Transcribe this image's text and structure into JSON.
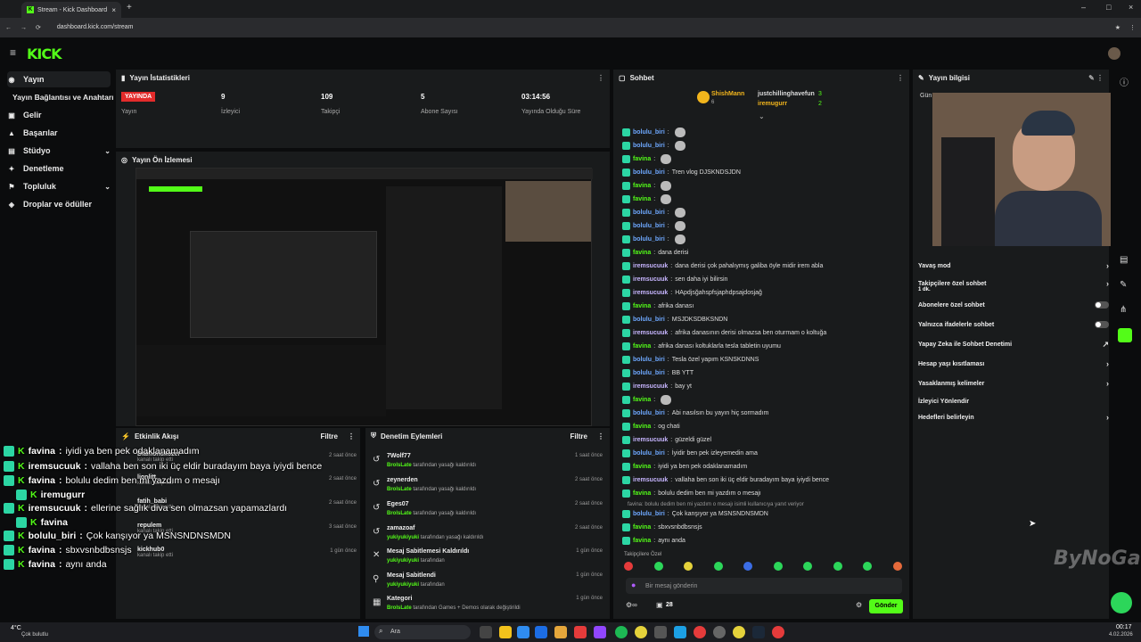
{
  "browser": {
    "tab_title": "Stream - Kick Dashboard",
    "url": "dashboard.kick.com/stream"
  },
  "brand": {
    "logo": "KICK",
    "accent": "#53fc18"
  },
  "sidebar": {
    "items": [
      {
        "label": "Yayın",
        "icon": "stream-icon"
      },
      {
        "label": "Yayın Bağlantısı ve Anahtarı",
        "icon": "key-icon"
      },
      {
        "label": "Gelir",
        "icon": "wallet-icon"
      },
      {
        "label": "Başarılar",
        "icon": "trophy-icon"
      },
      {
        "label": "Stüdyo",
        "icon": "studio-icon"
      },
      {
        "label": "Denetleme",
        "icon": "moderation-icon"
      },
      {
        "label": "Topluluk",
        "icon": "community-icon"
      },
      {
        "label": "Droplar ve ödüller",
        "icon": "drops-icon"
      }
    ]
  },
  "stats": {
    "title": "Yayın İstatistikleri",
    "live": "YAYINDA",
    "live_label": "Yayın",
    "items": [
      {
        "value": "9",
        "label": "İzleyici"
      },
      {
        "value": "109",
        "label": "Takipçi"
      },
      {
        "value": "5",
        "label": "Abone Sayısı"
      },
      {
        "value": "03:14:56",
        "label": "Yayında Olduğu Süre"
      }
    ]
  },
  "preview": {
    "title": "Yayın Ön İzlemesi"
  },
  "activity": {
    "title": "Etkinlik Akışı",
    "filter": "Filtre",
    "items": [
      {
        "name": "Diamondkozer",
        "sub": "kanalı takip etti",
        "time": "2 saat önce"
      },
      {
        "name": "lionlitt.",
        "sub": "kanalı takip etti",
        "time": "2 saat önce"
      },
      {
        "name": "fatih_babi",
        "sub": "kanalı takip etti",
        "time": "2 saat önce"
      },
      {
        "name": "repulem",
        "sub": "kanalı takip etti",
        "time": "3 saat önce"
      },
      {
        "name": "kickhub0",
        "sub": "kanalı takip etti",
        "time": "1 gün önce"
      }
    ]
  },
  "mod": {
    "title": "Denetim Eylemleri",
    "filter": "Filtre",
    "items": [
      {
        "name": "7Wolf77",
        "actor": "BrolsLate",
        "sub": "tarafından yasağı kaldırıldı",
        "time": "1 saat önce"
      },
      {
        "name": "zeynerden",
        "actor": "BrolsLate",
        "sub": "tarafından yasağı kaldırıldı",
        "time": "2 saat önce"
      },
      {
        "name": "Eges07",
        "actor": "BrolsLate",
        "sub": "tarafından yasağı kaldırıldı",
        "time": "2 saat önce"
      },
      {
        "name": "zamazoaf",
        "actor": "yukiyukiyuki",
        "sub": "tarafından yasağı kaldırıldı",
        "time": "2 saat önce"
      },
      {
        "name": "Mesaj Sabitlemesi Kaldırıldı",
        "actor": "yukiyukiyuki",
        "sub": "tarafından",
        "time": "1 gün önce"
      },
      {
        "name": "Mesaj Sabitlendi",
        "actor": "yukiyukiyuki",
        "sub": "tarafından",
        "time": "1 gün önce"
      },
      {
        "name": "Kategori",
        "actor": "BrolsLate",
        "sub": "tarafından Games + Demos olarak değiştirildi",
        "time": "1 gün önce"
      }
    ]
  },
  "chat": {
    "title": "Sohbet",
    "top": [
      {
        "name": "ShishMann",
        "count": "6"
      },
      {
        "name": "justchillinghavefun",
        "count": "3"
      },
      {
        "name": "iremugurr",
        "count": "2"
      }
    ],
    "messages": [
      {
        "user": "bolulu_biri",
        "text": "",
        "cls": "b"
      },
      {
        "user": "bolulu_biri",
        "text": "",
        "cls": "b"
      },
      {
        "user": "favina",
        "text": "",
        "cls": "f"
      },
      {
        "user": "bolulu_biri",
        "text": "Tren vlog DJSKNDSJDN",
        "cls": "b"
      },
      {
        "user": "favina",
        "text": "",
        "cls": "f"
      },
      {
        "user": "favina",
        "text": "",
        "cls": "f"
      },
      {
        "user": "bolulu_biri",
        "text": "",
        "cls": "b"
      },
      {
        "user": "bolulu_biri",
        "text": "",
        "cls": "b"
      },
      {
        "user": "bolulu_biri",
        "text": "",
        "cls": "b"
      },
      {
        "user": "favina",
        "text": "dana derisi",
        "cls": "f"
      },
      {
        "user": "iremsucuuk",
        "text": "dana derisi çok pahalıymış galiba öyle midir irem abla",
        "cls": "i"
      },
      {
        "user": "iremsucuuk",
        "text": "sen daha iyi bilirsin",
        "cls": "i"
      },
      {
        "user": "iremsucuuk",
        "text": "HApdjsğahspfsjaphdpsajdosjağ",
        "cls": "i"
      },
      {
        "user": "favina",
        "text": "afrika danası",
        "cls": "f"
      },
      {
        "user": "bolulu_biri",
        "text": "MSJDKSDBKSNDN",
        "cls": "b"
      },
      {
        "user": "iremsucuuk",
        "text": "afrika danasının derisi olmazsa ben oturmam o koltuğa",
        "cls": "i"
      },
      {
        "user": "favina",
        "text": "afrika danası koltuklarla tesla tabletin uyumu",
        "cls": "f"
      },
      {
        "user": "bolulu_biri",
        "text": "Tesla özel yapım KSNSKDNNS",
        "cls": "b"
      },
      {
        "user": "bolulu_biri",
        "text": "BB YTT",
        "cls": "b"
      },
      {
        "user": "iremsucuuk",
        "text": "bay yt",
        "cls": "i"
      },
      {
        "user": "favina",
        "text": "",
        "cls": "f"
      },
      {
        "user": "bolulu_biri",
        "text": "Abi nasılsın bu yayın hiç sormadım",
        "cls": "b"
      },
      {
        "user": "favina",
        "text": "og chati",
        "cls": "f"
      },
      {
        "user": "iremsucuuk",
        "text": "güzeldi güzel",
        "cls": "i"
      },
      {
        "user": "bolulu_biri",
        "text": "İyidir ben pek izleyemedin ama",
        "cls": "b"
      },
      {
        "user": "favina",
        "text": "iyidi ya ben pek odaklanamadım",
        "cls": "f"
      },
      {
        "user": "iremsucuuk",
        "text": "vallaha ben son iki üç eldir buradayım baya iyiydi bence",
        "cls": "i"
      },
      {
        "user": "favina",
        "text": "bolulu dedim ben mi yazdım o mesajı",
        "cls": "f"
      }
    ],
    "reply_note": "favina: bolulu dedim ben mi yazdım o mesajı isimli kullanıcıya yanıt veriyor",
    "messages2": [
      {
        "user": "bolulu_biri",
        "text": "Çok kanşıyor ya MSNSNDNSMDN",
        "cls": "b"
      },
      {
        "user": "favina",
        "text": "sbxvsnbdbsnsjs",
        "cls": "f"
      },
      {
        "user": "favina",
        "text": "aynı anda",
        "cls": "f"
      }
    ],
    "followers_only": "Takipçilere Özel",
    "input_placeholder": "Bir mesaj gönderin",
    "viewers": "28",
    "send": "Gönder"
  },
  "info": {
    "title": "Yayın bilgisi",
    "gun": "Gün"
  },
  "settings": {
    "items": [
      {
        "label": "Yavaş mod",
        "ctrl": "chevron"
      },
      {
        "label": "Takipçilere özel sohbet",
        "extra": "1 dk.",
        "ctrl": "chevron"
      },
      {
        "label": "Abonelere özel sohbet",
        "ctrl": "toggle"
      },
      {
        "label": "Yalnızca ifadelerle sohbet",
        "ctrl": "toggle"
      },
      {
        "label": "Yapay Zeka ile Sohbet Denetimi",
        "ctrl": "ext"
      },
      {
        "label": "Hesap yaşı kısıtlaması",
        "ctrl": "chevron"
      },
      {
        "label": "Yasaklanmış kelimeler",
        "ctrl": "chevron"
      },
      {
        "label": "İzleyici Yönlendir",
        "ctrl": "none"
      },
      {
        "label": "Hedefleri belirleyin",
        "ctrl": "chevron"
      }
    ]
  },
  "overlay": [
    {
      "user": "favina",
      "text": "iyidi ya ben pek odaklanamadım"
    },
    {
      "user": "iremsucuuk",
      "text": "vallaha ben son iki üç eldir buradayım baya iyiydi bence"
    },
    {
      "user": "favina",
      "text": "bolulu dedim ben mi yazdım o mesajı"
    },
    {
      "user": "iremugurr",
      "text": ""
    },
    {
      "user": "iremsucuuk",
      "text": "ellerine sağlık diva sen olmazsan yapamazlardı"
    },
    {
      "user": "favina",
      "text": ""
    },
    {
      "user": "bolulu_biri",
      "text": "Çok kanşıyor ya MSNSNDNSMDN"
    },
    {
      "user": "favina",
      "text": "sbxvsnbdbsnsjs"
    },
    {
      "user": "favina",
      "text": "aynı anda"
    }
  ],
  "watermark": "ByNoGame",
  "taskbar": {
    "temp": "4°C",
    "weather": "Çok bulutlu",
    "search": "Ara",
    "time": "00:17",
    "date": "4.02.2026"
  }
}
